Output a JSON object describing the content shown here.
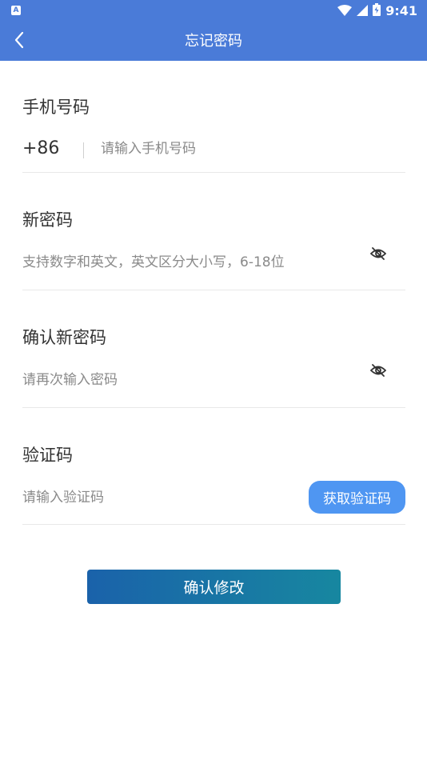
{
  "status_bar": {
    "left_icon": "A",
    "time": "9:41",
    "icons": [
      "wifi-icon",
      "signal-icon",
      "battery-icon"
    ]
  },
  "nav": {
    "title": "忘记密码",
    "back_icon": "chevron-left-icon"
  },
  "phone": {
    "label": "手机号码",
    "country_code": "+86",
    "placeholder": "请输入手机号码",
    "value": ""
  },
  "new_password": {
    "label": "新密码",
    "placeholder": "支持数字和英文，英文区分大小写，6-18位",
    "value": "",
    "toggle_icon": "eye-off-icon"
  },
  "confirm_password": {
    "label": "确认新密码",
    "placeholder": "请再次输入密码",
    "value": "",
    "toggle_icon": "eye-off-icon"
  },
  "verification": {
    "label": "验证码",
    "placeholder": "请输入验证码",
    "value": "",
    "button_label": "获取验证码"
  },
  "submit": {
    "label": "确认修改"
  },
  "colors": {
    "header": "#4a7bd8",
    "code_button": "#4f96f2",
    "submit_gradient_start": "#1a62aa",
    "submit_gradient_end": "#1787a0"
  }
}
